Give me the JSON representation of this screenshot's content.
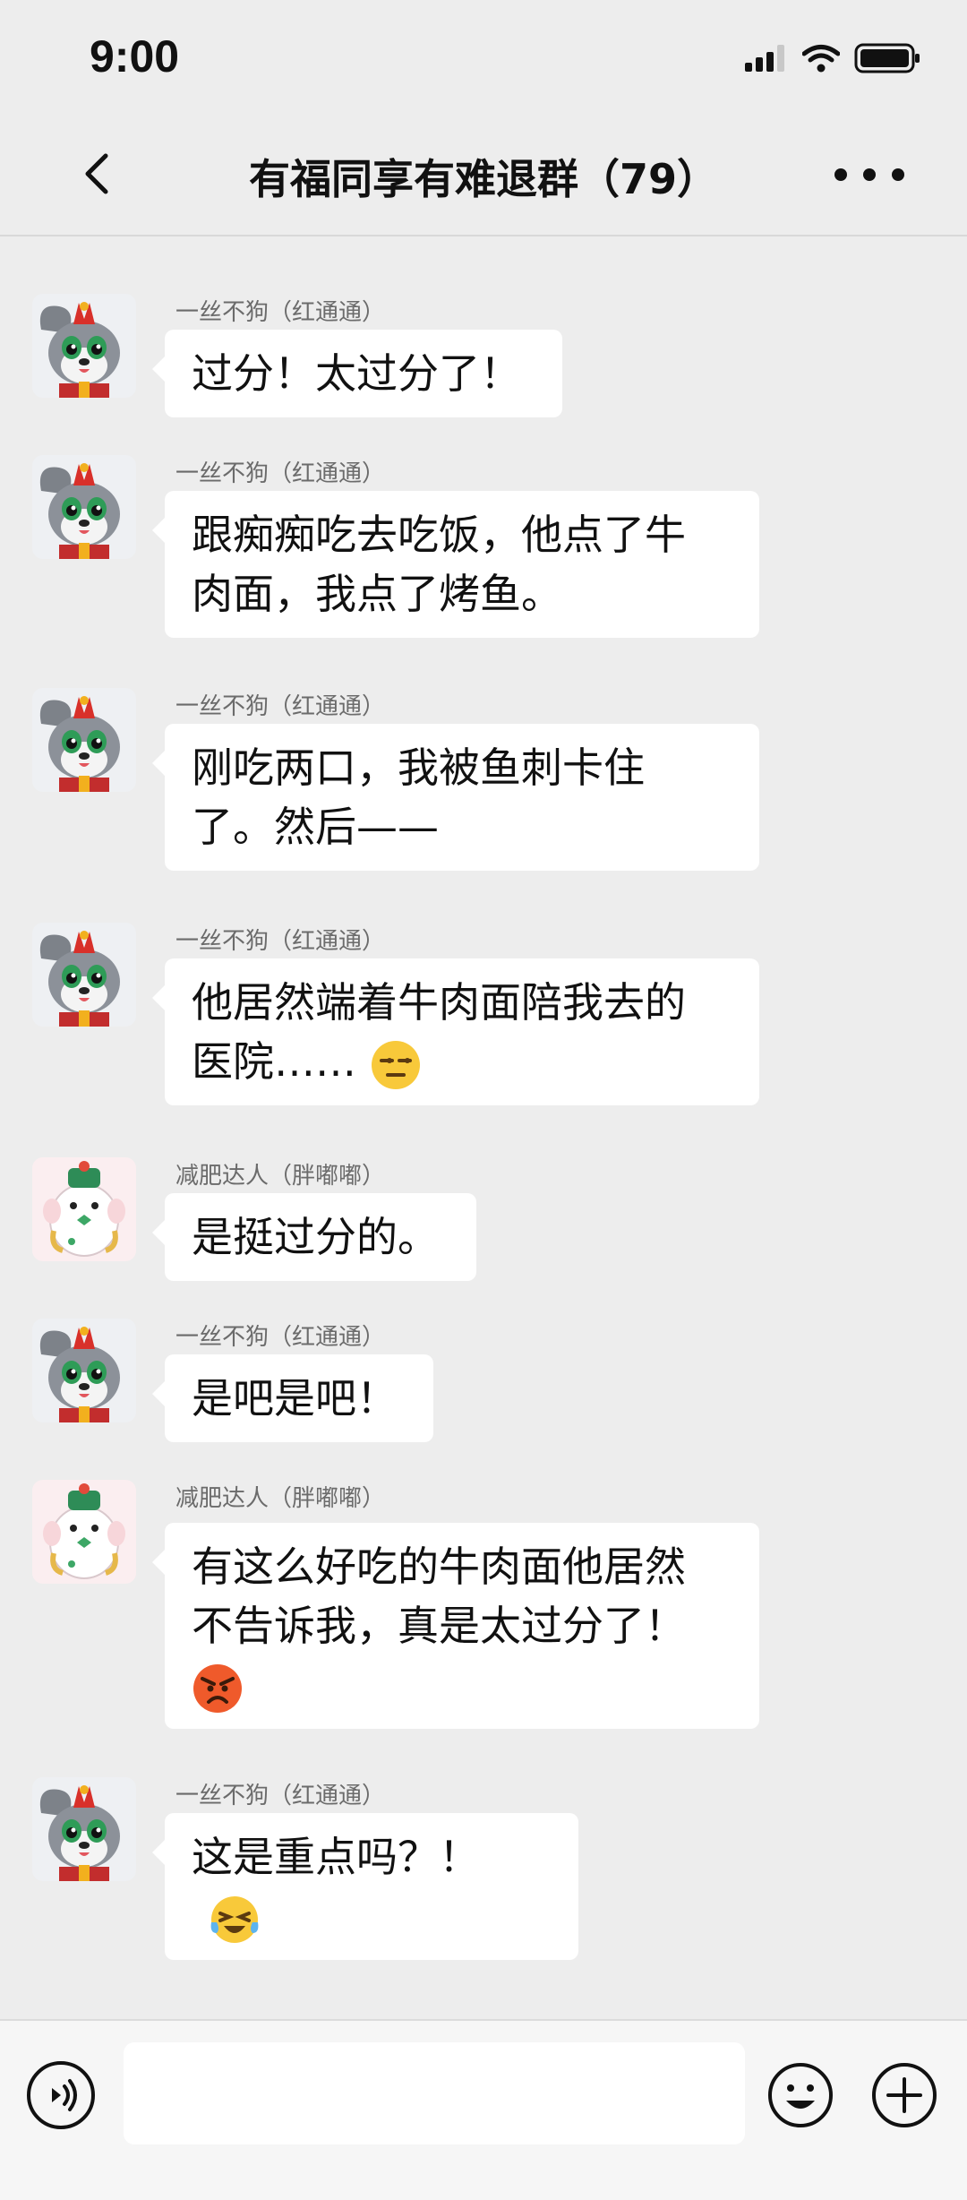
{
  "status": {
    "time": "9:00"
  },
  "header": {
    "title": "有福同享有难退群（79）"
  },
  "colors": {
    "background": "#ededed",
    "bubble": "#ffffff",
    "text": "#111111"
  },
  "messages": [
    {
      "sender": "一丝不狗（红通通）",
      "avatar": "gray-dog-avatar",
      "text": "过分！太过分了！"
    },
    {
      "sender": "一丝不狗（红通通）",
      "avatar": "gray-dog-avatar",
      "lines": [
        "跟痴痴吃去吃饭，他点了牛",
        "肉面，我点了烤鱼。"
      ]
    },
    {
      "sender": "一丝不狗（红通通）",
      "avatar": "gray-dog-avatar",
      "lines": [
        "刚吃两口，我被鱼刺卡住",
        "了。然后——"
      ]
    },
    {
      "sender": "一丝不狗（红通通）",
      "avatar": "gray-dog-avatar",
      "lines": [
        "他居然端着牛肉面陪我去的",
        "医院……"
      ],
      "emoji": "unamused-face-emoji"
    },
    {
      "sender": "减肥达人（胖嘟嘟）",
      "avatar": "white-pig-avatar",
      "text": "是挺过分的。"
    },
    {
      "sender": "一丝不狗（红通通）",
      "avatar": "gray-dog-avatar",
      "text": "是吧是吧！"
    },
    {
      "sender": "减肥达人（胖嘟嘟）",
      "avatar": "white-pig-avatar",
      "lines": [
        "有这么好吃的牛肉面他居然",
        "不告诉我，真是太过分了！"
      ],
      "emoji": "angry-face-emoji"
    },
    {
      "sender": "一丝不狗（红通通）",
      "avatar": "gray-dog-avatar",
      "text": "这是重点吗？！",
      "emoji": "laughing-tears-face-emoji"
    }
  ],
  "input": {
    "placeholder": ""
  }
}
